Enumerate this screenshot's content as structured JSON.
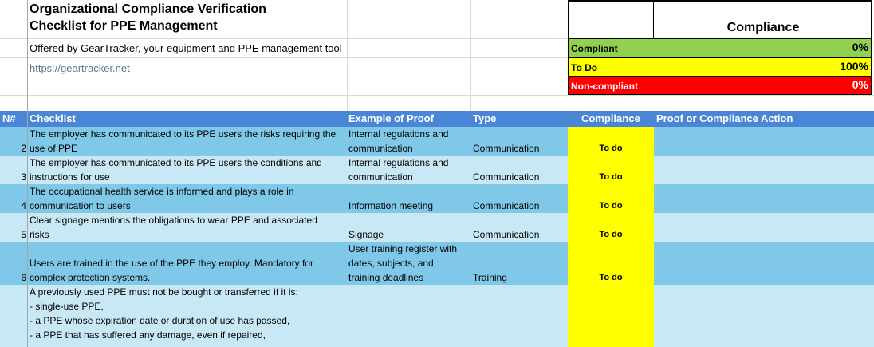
{
  "header": {
    "title_line1": "Organizational Compliance Verification",
    "title_line2": "Checklist for PPE Management",
    "subtitle": "Offered by GearTracker, your equipment and PPE management tool",
    "link": "https://geartracker.net"
  },
  "summary": {
    "heading": "Compliance",
    "rows": [
      {
        "label": "Compliant",
        "value": "0%",
        "color": "#92d050"
      },
      {
        "label": "To Do",
        "value": "100%",
        "color": "#ffff00"
      },
      {
        "label": "Non-compliant",
        "value": "0%",
        "color": "#ff0000"
      }
    ]
  },
  "table": {
    "columns": [
      "N#",
      "Checklist",
      "Example of Proof",
      "Type",
      "Compliance",
      "Proof or Compliance Action"
    ],
    "rows": [
      {
        "num": "2",
        "checklist": [
          "The employer has communicated to its PPE users the risks requiring the",
          "use of PPE"
        ],
        "proof": [
          "Internal regulations and",
          "communication"
        ],
        "type": "Communication",
        "compliance": "To do"
      },
      {
        "num": "3",
        "checklist": [
          "The employer has communicated to its PPE users the conditions and",
          "instructions for use"
        ],
        "proof": [
          "Internal regulations and",
          "communication"
        ],
        "type": "Communication",
        "compliance": "To do"
      },
      {
        "num": "4",
        "checklist": [
          "The occupational health service is informed and plays a role in",
          "communication to users"
        ],
        "proof": [
          "",
          "Information meeting"
        ],
        "type": "Communication",
        "compliance": "To do"
      },
      {
        "num": "5",
        "checklist": [
          "Clear signage mentions the obligations to wear PPE and associated",
          "risks"
        ],
        "proof": [
          "",
          "Signage"
        ],
        "type": "Communication",
        "compliance": "To do"
      },
      {
        "num": "6",
        "checklist": [
          "",
          "Users are trained in the use of the PPE they employ. Mandatory for",
          "complex protection systems."
        ],
        "proof": [
          "User training register with",
          "dates, subjects, and",
          "training deadlines"
        ],
        "type": "Training",
        "compliance": "To do"
      },
      {
        "num": "",
        "checklist": [
          "A previously used PPE must not be bought or transferred if it is:",
          "- single-use PPE,",
          "- a PPE whose expiration date or duration of use has passed,",
          "- a PPE that has suffered any damage, even if repaired,"
        ],
        "proof": [],
        "type": "",
        "compliance": ""
      }
    ]
  }
}
